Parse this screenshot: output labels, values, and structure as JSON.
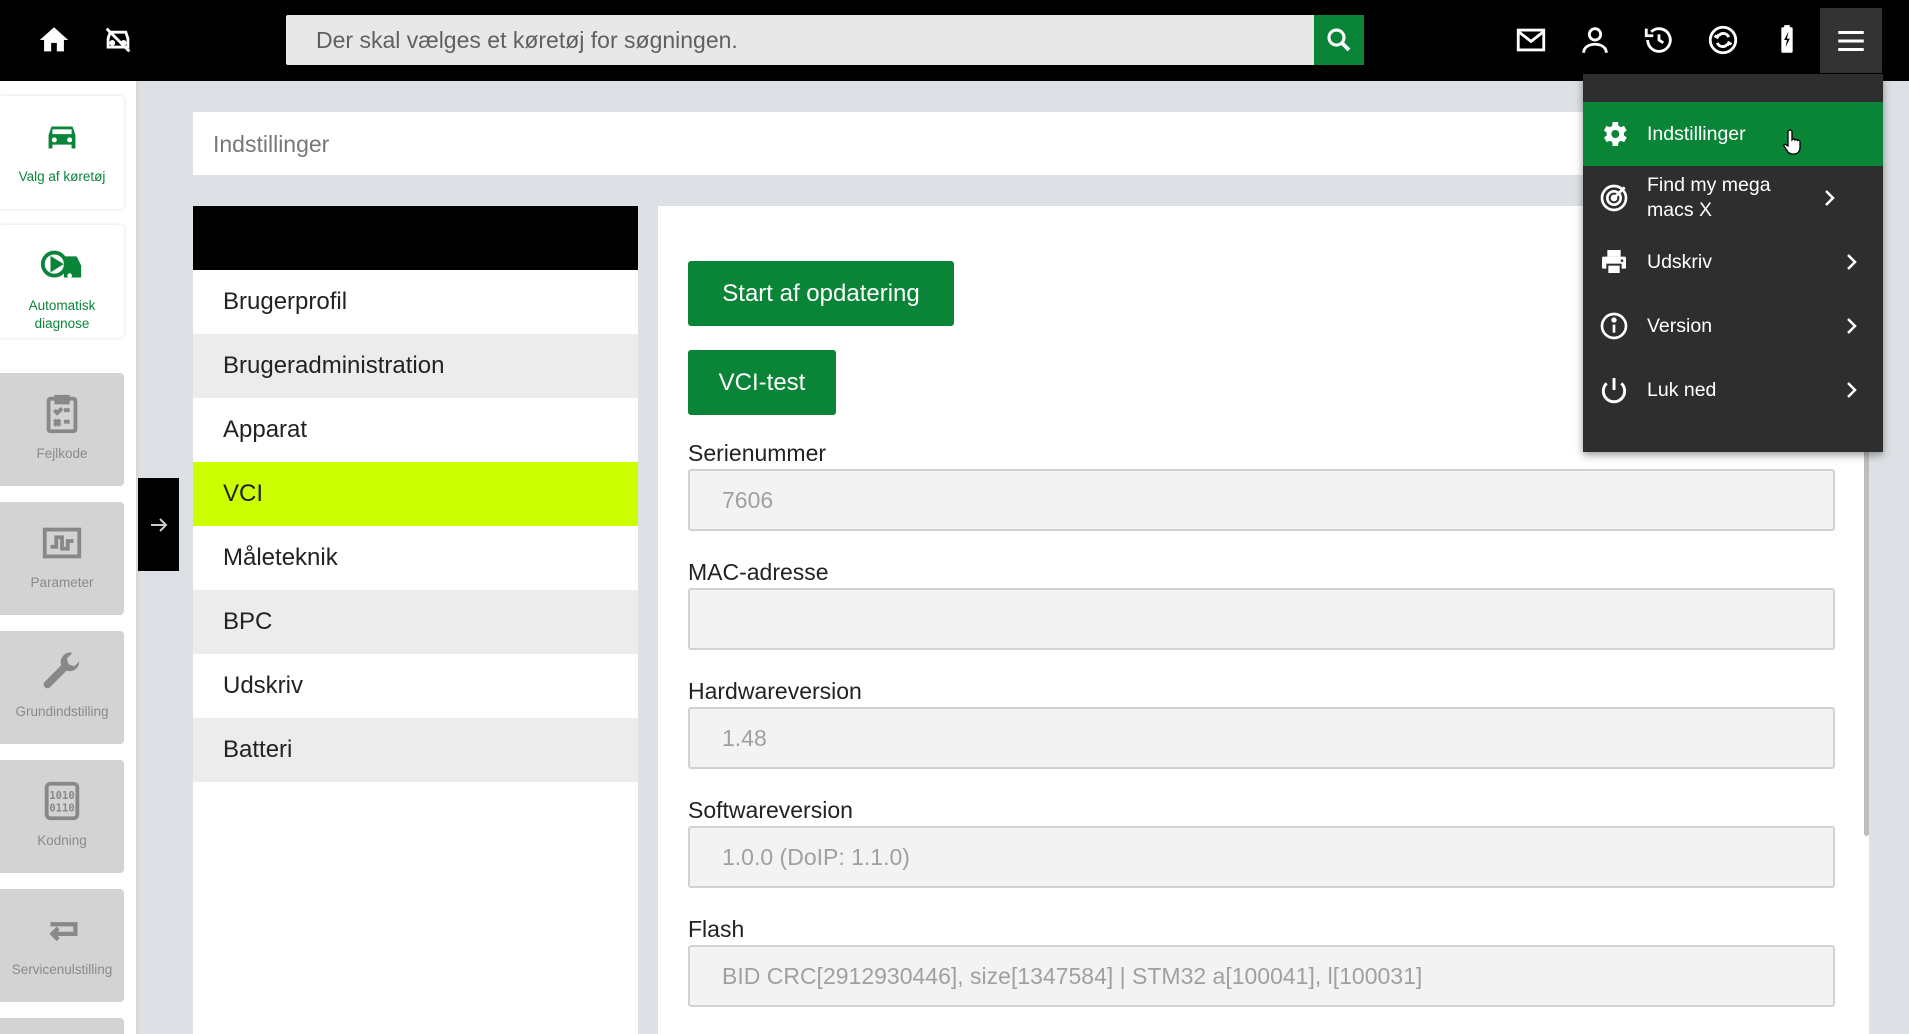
{
  "topbar": {
    "search_placeholder": "Der skal vælges et køretøj for søgningen.",
    "icons": [
      "home-icon",
      "no-vehicle-icon",
      "search-icon",
      "mail-icon",
      "user-icon",
      "history-icon",
      "sync-icon",
      "battery-icon",
      "hamburger-menu-icon"
    ]
  },
  "leftnav": {
    "items": [
      {
        "label": "Valg af køretøj",
        "icon": "car-icon",
        "active": true
      },
      {
        "label": "Automatisk diagnose",
        "icon": "auto-diagnosis-icon",
        "active": true
      },
      {
        "label": "Fejlkode",
        "icon": "fault-code-icon",
        "active": false
      },
      {
        "label": "Parameter",
        "icon": "parameter-icon",
        "active": false
      },
      {
        "label": "Grundindstilling",
        "icon": "wrench-icon",
        "active": false
      },
      {
        "label": "Kodning",
        "icon": "coding-icon",
        "active": false
      },
      {
        "label": "Servicenulstilling",
        "icon": "service-reset-icon",
        "active": false
      }
    ]
  },
  "breadcrumb": {
    "title": "Indstillinger"
  },
  "settings_list": {
    "items": [
      "Brugerprofil",
      "Brugeradministration",
      "Apparat",
      "VCI",
      "Måleteknik",
      "BPC",
      "Udskriv",
      "Batteri"
    ],
    "selected": "VCI"
  },
  "main": {
    "start_update_label": "Start af opdatering",
    "vci_test_label": "VCI-test",
    "fields": [
      {
        "label": "Serienummer",
        "value": "7606"
      },
      {
        "label": "MAC-adresse",
        "value": ""
      },
      {
        "label": "Hardwareversion",
        "value": "1.48"
      },
      {
        "label": "Softwareversion",
        "value": "1.0.0 (DoIP: 1.1.0)"
      },
      {
        "label": "Flash",
        "value": "BID CRC[2912930446], size[1347584] | STM32 a[100041], l[100031]"
      }
    ]
  },
  "dropdown": {
    "items": [
      {
        "label": "Indstillinger",
        "icon": "gear-icon",
        "active": true,
        "has_arrow": false
      },
      {
        "label": "Find my mega macs X",
        "icon": "target-icon",
        "active": false,
        "has_arrow": true
      },
      {
        "label": "Udskriv",
        "icon": "printer-icon",
        "active": false,
        "has_arrow": true
      },
      {
        "label": "Version",
        "icon": "info-icon",
        "active": false,
        "has_arrow": true
      },
      {
        "label": "Luk ned",
        "icon": "power-icon",
        "active": false,
        "has_arrow": true
      }
    ]
  },
  "colors": {
    "accent_green": "#0a8538",
    "selection_yellow": "#ccff00",
    "topbar_black": "#000000"
  }
}
